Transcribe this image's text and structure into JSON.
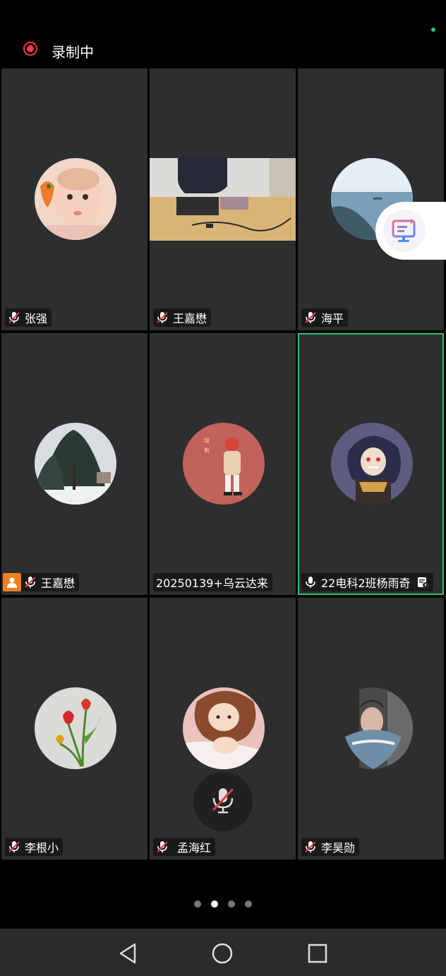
{
  "recording": {
    "label": "录制中"
  },
  "participants": [
    {
      "name": "张强",
      "mic": "muted",
      "avatar": "baby-photo-avatar"
    },
    {
      "name": "王嘉懋",
      "mic": "muted",
      "avatar": "camera-video-feed"
    },
    {
      "name": "海平",
      "mic": "muted",
      "avatar": "coast-photo-avatar"
    },
    {
      "name": "王嘉懋",
      "mic": "muted",
      "avatar": "snow-trees-avatar",
      "screen_share": true
    },
    {
      "name": "20250139+乌云达来",
      "mic": "none",
      "avatar": "cartoon-girl-avatar"
    },
    {
      "name": "22电科2班杨雨奇",
      "mic": "on",
      "avatar": "anime-character-avatar",
      "active_speaker": true
    },
    {
      "name": "李根小",
      "mic": "muted",
      "avatar": "tulip-flowers-avatar"
    },
    {
      "name": "孟海红",
      "mic": "muted",
      "avatar": "mother-baby-illustration-avatar"
    },
    {
      "name": "李昊勋",
      "mic": "muted",
      "avatar": "person-scarf-avatar"
    }
  ],
  "pager": {
    "pages": 4,
    "current": 2
  },
  "colors": {
    "accent": "#2fc364",
    "record": "#ff3b3b",
    "muted_mic": "#e23a3a",
    "tile_bg": "#2d2e30"
  }
}
